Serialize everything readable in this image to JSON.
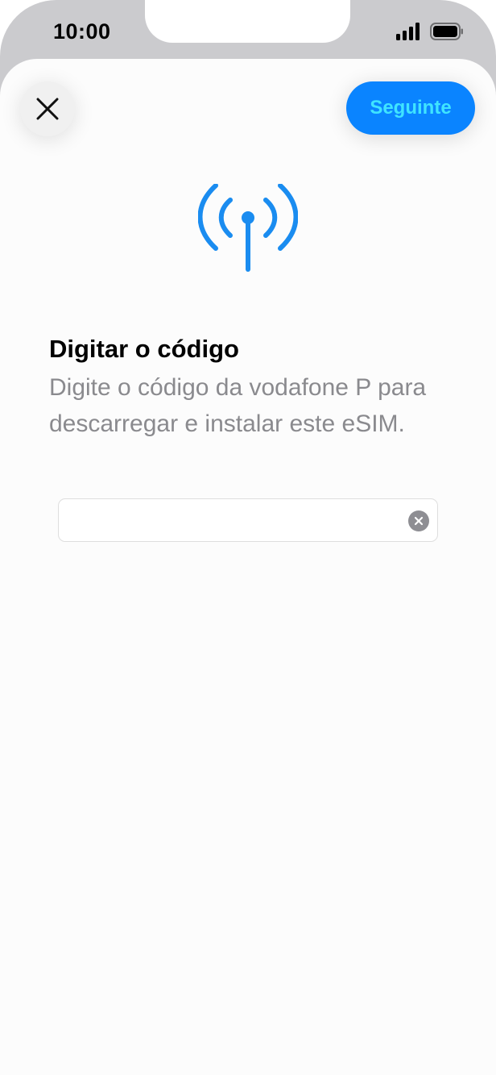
{
  "status_bar": {
    "time": "10:00",
    "icons": [
      "signal-icon",
      "battery-icon"
    ]
  },
  "toolbar": {
    "close_icon": "close-icon",
    "next_label": "Seguinte"
  },
  "content": {
    "icon": "antenna-icon",
    "title": "Digitar o código",
    "subtitle": "Digite o código da vodafone P para descarregar e instalar este eSIM."
  },
  "code_field": {
    "value": "",
    "placeholder": "",
    "clear_icon": "clear-icon"
  },
  "colors": {
    "accent": "#0a84ff",
    "button_text": "#3fe4ff",
    "icon_blue": "#1a8cf0",
    "secondary_text": "#8a8a8e"
  }
}
